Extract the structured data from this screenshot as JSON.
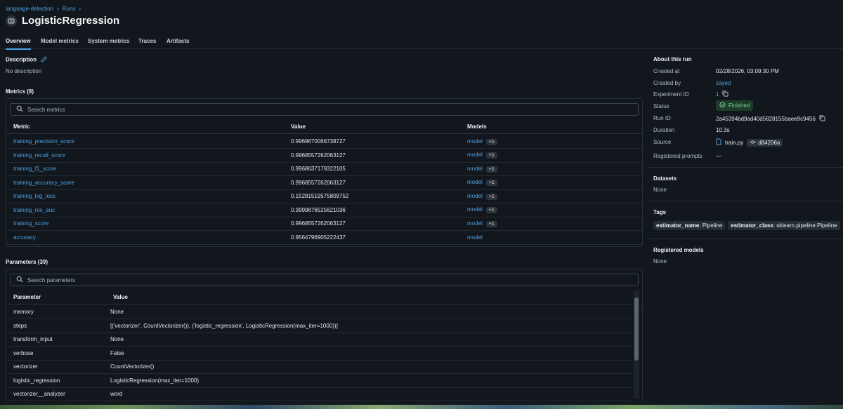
{
  "breadcrumb": {
    "experiment": "language-detection",
    "runs": "Runs"
  },
  "title": "LogisticRegression",
  "tabs": [
    "Overview",
    "Model metrics",
    "System metrics",
    "Traces",
    "Artifacts"
  ],
  "description": {
    "heading": "Description",
    "text": "No description"
  },
  "metrics": {
    "heading": "Metrics (8)",
    "search_placeholder": "Search metrics",
    "columns": [
      "Metric",
      "Value",
      "Models"
    ],
    "rows": [
      {
        "name": "training_precision_score",
        "value": "0.9969670066738727",
        "model": "model",
        "extra": "+1"
      },
      {
        "name": "training_recall_score",
        "value": "0.9968557262063127",
        "model": "model",
        "extra": "+1"
      },
      {
        "name": "training_f1_score",
        "value": "0.9968637179322105",
        "model": "model",
        "extra": "+1"
      },
      {
        "name": "training_accuracy_score",
        "value": "0.9968557262063127",
        "model": "model",
        "extra": "+1"
      },
      {
        "name": "training_log_loss",
        "value": "0.15281519575809752",
        "model": "model",
        "extra": "+1"
      },
      {
        "name": "training_roc_auc",
        "value": "0.9999876525621036",
        "model": "model",
        "extra": "+1"
      },
      {
        "name": "training_score",
        "value": "0.9968557262063127",
        "model": "model",
        "extra": "+1"
      },
      {
        "name": "accuracy",
        "value": "0.9564796905222437",
        "model": "model",
        "extra": ""
      }
    ]
  },
  "parameters": {
    "heading": "Parameters (39)",
    "search_placeholder": "Search parameters",
    "columns": [
      "Parameter",
      "Value"
    ],
    "rows": [
      {
        "name": "memory",
        "value": "None"
      },
      {
        "name": "steps",
        "value": "[('vectorizer', CountVectorizer()), ('logistic_regression', LogisticRegression(max_iter=1000))]"
      },
      {
        "name": "transform_input",
        "value": "None"
      },
      {
        "name": "verbose",
        "value": "False"
      },
      {
        "name": "vectorizer",
        "value": "CountVectorizer()"
      },
      {
        "name": "logistic_regression",
        "value": "LogisticRegression(max_iter=1000)"
      },
      {
        "name": "vectorizer__analyzer",
        "value": "word"
      }
    ],
    "scroll_position": 0.0,
    "scroll_visible_fraction": 0.7
  },
  "about": {
    "heading": "About this run",
    "created_at_label": "Created at",
    "created_at": "02/28/2026, 03:09:30 PM",
    "created_by_label": "Created by",
    "created_by": "zayed",
    "experiment_id_label": "Experiment ID",
    "experiment_id": "1",
    "status_label": "Status",
    "status": "Finished",
    "run_id_label": "Run ID",
    "run_id": "2a45394bd9ad40d5828155baee9c9456",
    "duration_label": "Duration",
    "duration": "10.3s",
    "source_label": "Source",
    "source_file": "train.py",
    "source_commit": "d84206a",
    "registered_prompts_label": "Registered prompts",
    "registered_prompts": "—"
  },
  "datasets": {
    "heading": "Datasets",
    "value": "None"
  },
  "tags": {
    "heading": "Tags",
    "items": [
      {
        "key": "estimator_name",
        "value": "Pipeline"
      },
      {
        "key": "estimator_class",
        "value": "sklearn.pipeline.Pipeline"
      }
    ]
  },
  "registered_models": {
    "heading": "Registered models",
    "value": "None"
  },
  "colors": {
    "accent": "#4ea1e6",
    "success": "#7fd39a",
    "background": "#11171c"
  }
}
